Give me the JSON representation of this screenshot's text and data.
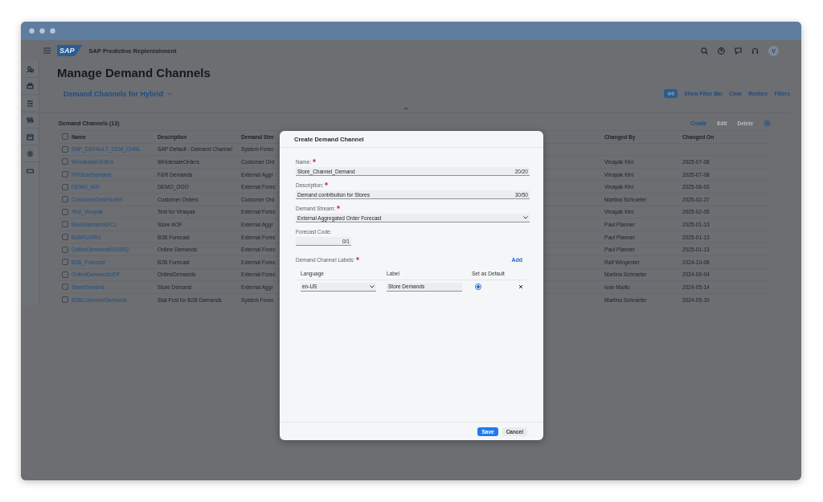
{
  "shell": {
    "logo": "SAP",
    "title": "SAP Predictive Replenishment",
    "avatar": "V"
  },
  "page": {
    "title": "Manage Demand Channels",
    "variant": "Demand Channels for Hybrid",
    "filter_actions": [
      "Show Filter Bar",
      "Clear",
      "Restore",
      "Filters"
    ]
  },
  "table": {
    "title": "Demand Channels (13)",
    "actions": [
      {
        "label": "Create",
        "disabled": false
      },
      {
        "label": "Edit",
        "disabled": true
      },
      {
        "label": "Delete",
        "disabled": true
      }
    ],
    "all_selected": false,
    "columns": [
      "Name",
      "Description",
      "Demand Stre",
      "Changed By",
      "Changed On"
    ],
    "rows": [
      {
        "selected": false,
        "cells": [
          "SAP_DEFAULT_DEM_CHNL",
          "SAP Default - Demand Channel",
          "System Forec",
          "",
          ""
        ]
      },
      {
        "selected": false,
        "cells": [
          "WHolesaleOrders",
          "WHolesaleOrders",
          "Customer Ord",
          "Vinayak Kini",
          "2025-07-08"
        ]
      },
      {
        "selected": false,
        "cells": [
          "FRStoreDemand",
          "F&R Demands",
          "External Aggr",
          "Vinayak Kini",
          "2025-07-08"
        ]
      },
      {
        "selected": false,
        "cells": [
          "DEMO_000",
          "DEMO_OOO",
          "External Forec",
          "Vinayak Kini",
          "2025-06-03"
        ]
      },
      {
        "selected": false,
        "cells": [
          "CustomerOrderNoSei",
          "Customer Orders",
          "Customer Ord",
          "Martina Schroeter",
          "2025-02-27"
        ]
      },
      {
        "selected": false,
        "cells": [
          "Test_Vinayak",
          "Test for Vinayak",
          "External Forec",
          "Vinayak Kini",
          "2025-02-05"
        ]
      },
      {
        "selected": false,
        "cells": [
          "StoreDemandsFC1",
          "Store AOF",
          "External Aggr",
          "Paul Planner",
          "2025-01-13"
        ]
      },
      {
        "selected": false,
        "cells": [
          "B2BR100R1",
          "B2B Forecast",
          "External Forec",
          "Paul Planner",
          "2025-01-13"
        ]
      },
      {
        "selected": false,
        "cells": [
          "OnlineDemandsR100R2",
          "Online Demands",
          "External Forec",
          "Paul Planner",
          "2025-01-13"
        ]
      },
      {
        "selected": false,
        "cells": [
          "B2B_Forecast",
          "B2B Forecast",
          "External Forec",
          "Ralf Wingenter",
          "2024-10-08"
        ]
      },
      {
        "selected": false,
        "cells": [
          "OnlineDemandsUDF",
          "OnlineDemands",
          "External Forec",
          "Martina Schroeter",
          "2024-09-04"
        ]
      },
      {
        "selected": false,
        "cells": [
          "StoreDemand",
          "Store Demand",
          "External Aggr",
          "Ivan Marlic",
          "2024-05-14"
        ]
      },
      {
        "selected": false,
        "cells": [
          "B2BCustomerDemands",
          "Stat Fcst for B2B Demands",
          "System Forec",
          "Martina Schroeter",
          "2024-05-10"
        ]
      }
    ]
  },
  "dialog": {
    "title": "Create Demand Channel",
    "fields": [
      {
        "kind": "text",
        "label": "Name:",
        "required": true,
        "value": "Store_Channel_Demand",
        "counter": "20/20"
      },
      {
        "kind": "text",
        "label": "Description:",
        "required": true,
        "value": "Demand contribution for Stores",
        "counter": "30/50"
      },
      {
        "kind": "select",
        "label": "Demand Stream:",
        "required": true,
        "value": "External Aggregated Order Forecast"
      },
      {
        "kind": "short",
        "label": "Forecast Code:",
        "counter": "0/1"
      }
    ],
    "labels": {
      "label": "Demand Channel Labels:",
      "required": true,
      "add": "Add",
      "columns": [
        "Language",
        "Label",
        "Set as Default"
      ],
      "rows": [
        {
          "language": "en-US",
          "label": "Store Demands",
          "selected": true
        }
      ]
    },
    "buttons": [
      {
        "label": "Save",
        "kind": "primary"
      },
      {
        "label": "Cancel",
        "kind": "plain"
      }
    ]
  }
}
